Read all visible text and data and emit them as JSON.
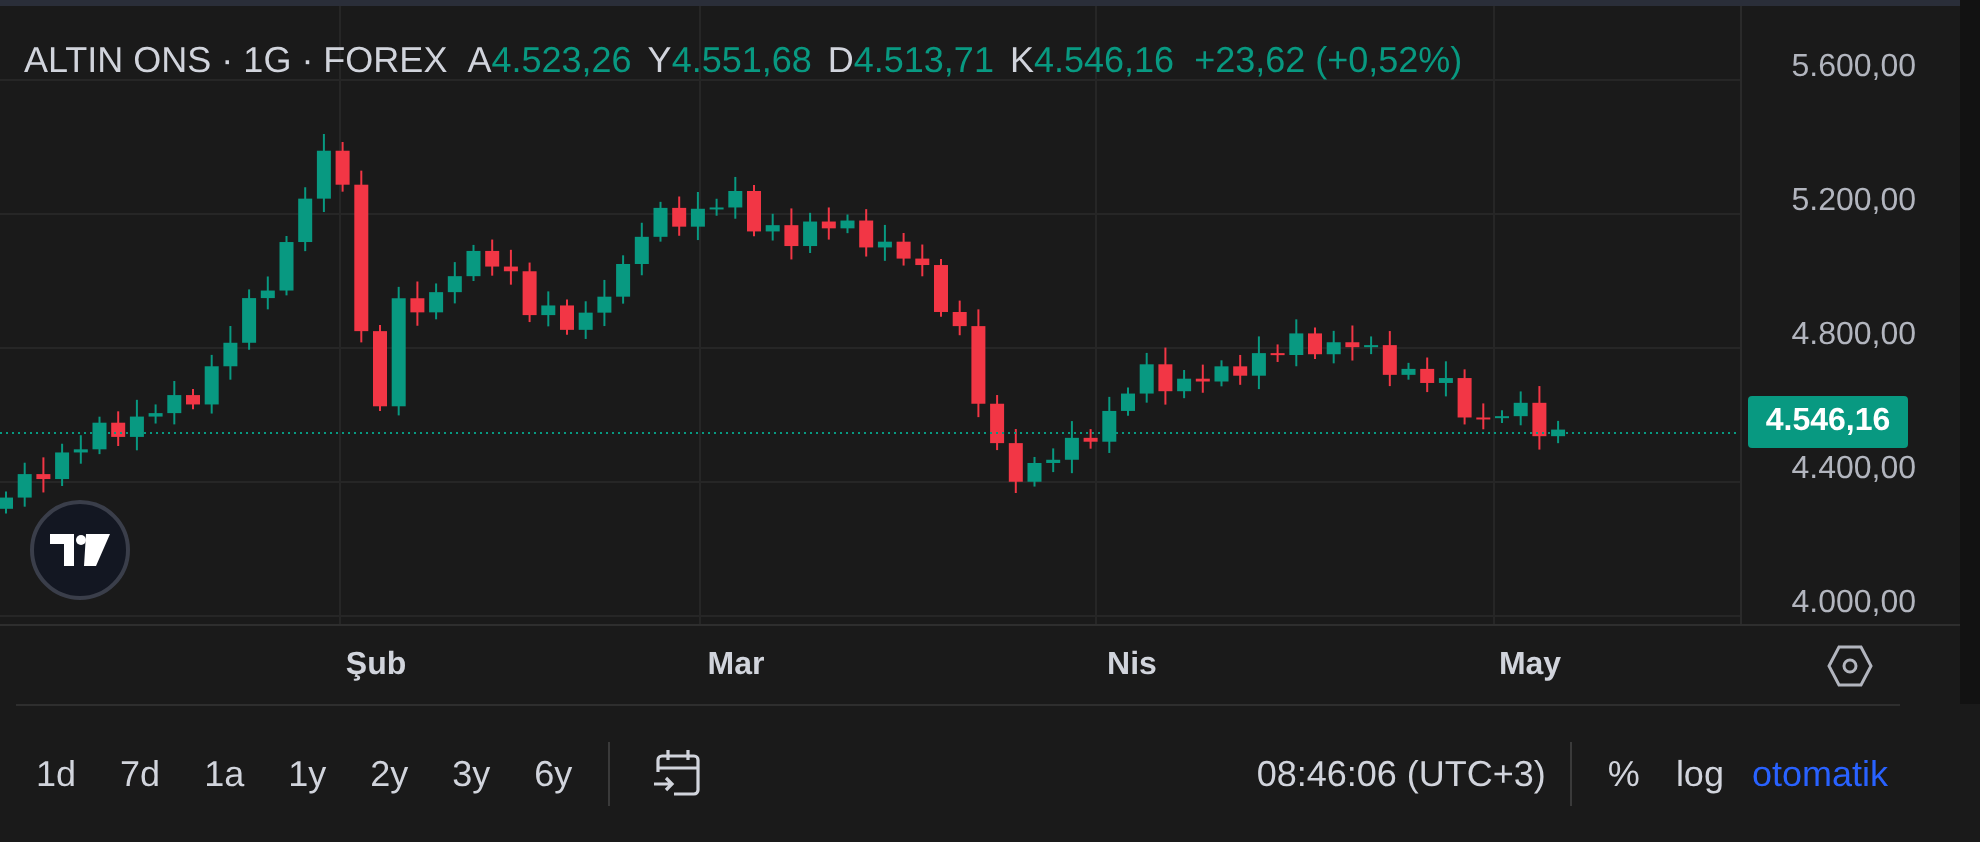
{
  "header": {
    "symbol": "ALTIN ONS · 1G · FOREX",
    "ohlc": [
      {
        "label": "A",
        "value": "4.523,26"
      },
      {
        "label": "Y",
        "value": "4.551,68"
      },
      {
        "label": "D",
        "value": "4.513,71"
      },
      {
        "label": "K",
        "value": "4.546,16"
      }
    ],
    "change": "+23,62 (+0,52%)"
  },
  "price_axis": {
    "ticks": [
      "5.600,00",
      "5.200,00",
      "4.800,00",
      "4.400,00",
      "4.000,00"
    ],
    "last_price": "4.546,16"
  },
  "time_axis": {
    "labels": [
      "Şub",
      "Mar",
      "Nis",
      "May"
    ]
  },
  "toolbar": {
    "ranges": [
      "1d",
      "7d",
      "1a",
      "1y",
      "2y",
      "3y",
      "6y"
    ],
    "time": "08:46:06 (UTC+3)",
    "percent": "%",
    "log": "log",
    "auto": {
      "label": "otomatik",
      "on": true
    }
  }
}
